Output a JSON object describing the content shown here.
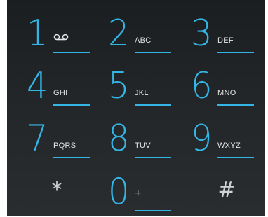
{
  "dialpad": {
    "keys": [
      {
        "digit": "1",
        "letters": "",
        "icon": "voicemail-icon"
      },
      {
        "digit": "2",
        "letters": "ABC"
      },
      {
        "digit": "3",
        "letters": "DEF"
      },
      {
        "digit": "4",
        "letters": "GHI"
      },
      {
        "digit": "5",
        "letters": "JKL"
      },
      {
        "digit": "6",
        "letters": "MNO"
      },
      {
        "digit": "7",
        "letters": "PQRS"
      },
      {
        "digit": "8",
        "letters": "TUV"
      },
      {
        "digit": "9",
        "letters": "WXYZ"
      },
      {
        "symbol": "*"
      },
      {
        "digit": "0",
        "letters": "+"
      },
      {
        "symbol": "#"
      }
    ]
  },
  "colors": {
    "accent": "#33b5e5",
    "background": "#232629",
    "letters": "#e6e6e6"
  }
}
